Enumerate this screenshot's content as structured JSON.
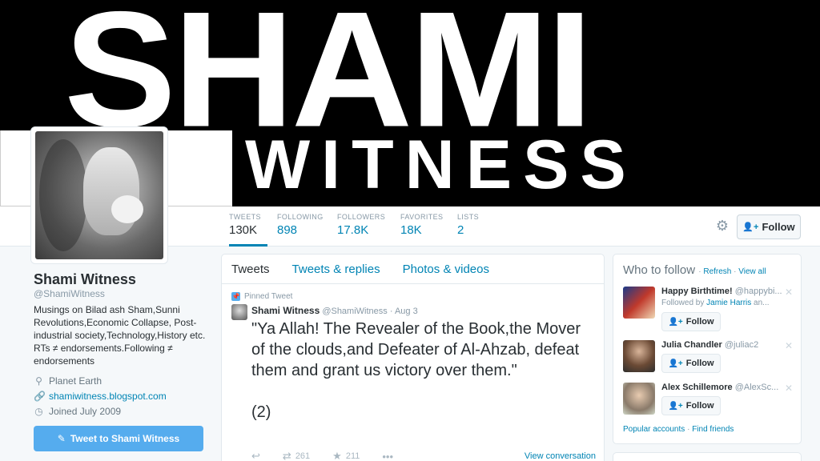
{
  "banner": {
    "line1": "SHAMI",
    "line2": "WITNESS"
  },
  "stats": [
    {
      "label": "TWEETS",
      "value": "130K"
    },
    {
      "label": "FOLLOWING",
      "value": "898"
    },
    {
      "label": "FOLLOWERS",
      "value": "17.8K"
    },
    {
      "label": "FAVORITES",
      "value": "18K"
    },
    {
      "label": "LISTS",
      "value": "2"
    }
  ],
  "header": {
    "follow_label": "Follow"
  },
  "profile": {
    "name": "Shami Witness",
    "handle": "@ShamiWitness",
    "bio": "Musings on Bilad ash Sham,Sunni Revolutions,Economic Collapse, Post-industrial society,Technology,History etc. RTs ≠ endorsements.Following ≠ endorsements",
    "location": "Planet Earth",
    "website": "shamiwitness.blogspot.com",
    "joined": "Joined July 2009",
    "tweet_to_label": "Tweet to Shami Witness"
  },
  "timeline": {
    "tabs": [
      "Tweets",
      "Tweets & replies",
      "Photos & videos"
    ],
    "pinned_label": "Pinned Tweet",
    "tweet": {
      "author": "Shami Witness",
      "handle": "@ShamiWitness",
      "sep": "·",
      "date": "Aug 3",
      "text": "\"Ya Allah! The Revealer of the Book,the Mover of the clouds,and Defeater of Al-Ahzab, defeat them and grant us victory over them.\"\n\n(2)",
      "retweets": "261",
      "favorites": "211",
      "view_conversation": "View conversation"
    }
  },
  "who_to_follow": {
    "title": "Who to follow",
    "sep": "·",
    "refresh": "Refresh",
    "view_all": "View all",
    "items": [
      {
        "name": "Happy Birthtime!",
        "handle": "@happybi...",
        "followed_by_prefix": "Followed by",
        "followed_by": "Jamie Harris",
        "followed_by_suffix": "an...",
        "follow_label": "Follow"
      },
      {
        "name": "Julia Chandler",
        "handle": "@juliac2",
        "follow_label": "Follow"
      },
      {
        "name": "Alex Schillemore",
        "handle": "@AlexSc...",
        "follow_label": "Follow"
      }
    ],
    "footer": {
      "popular": "Popular accounts",
      "sep": "·",
      "find": "Find friends"
    }
  },
  "colors": {
    "accent": "#0084b4",
    "button_blue": "#55acee",
    "banner_black": "#000000"
  },
  "icons": {
    "gear": "gear-icon",
    "follow": "person-plus-icon",
    "location": "map-pin-icon",
    "link": "link-icon",
    "calendar": "calendar-icon",
    "compose": "compose-icon",
    "pin": "pin-icon",
    "reply": "reply-icon",
    "retweet": "retweet-icon",
    "favorite": "star-icon",
    "more": "more-dots-icon",
    "dismiss": "close-icon"
  }
}
